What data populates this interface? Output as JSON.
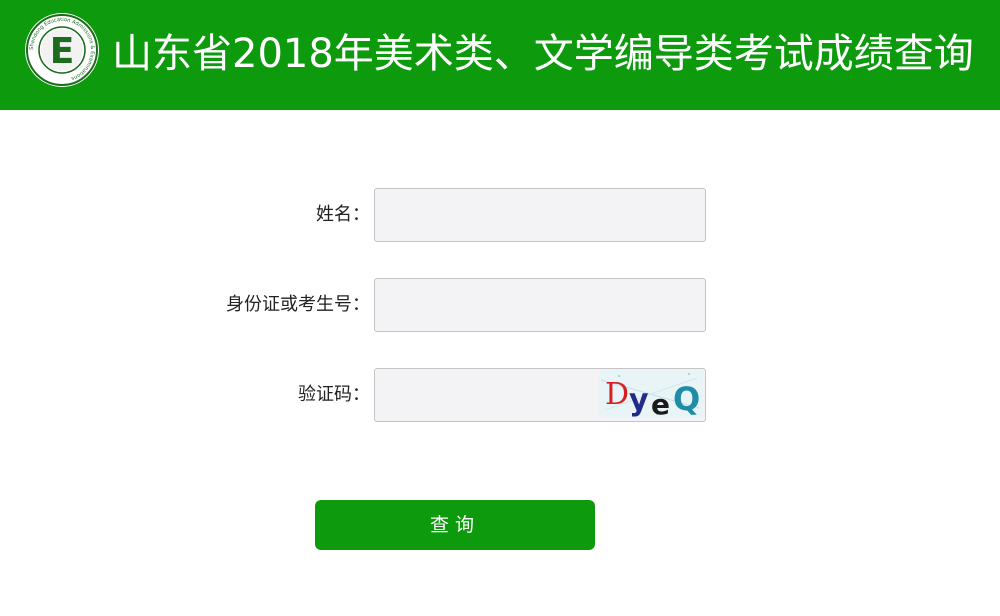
{
  "header": {
    "title": "山东省2018年美术类、文学编导类考试成绩查询",
    "background_color": "#0d9a0d",
    "logo": {
      "icon": "exam-institute-logo-icon",
      "letter": "E",
      "ring_text": "Shandong Education Admissions & Examinations"
    }
  },
  "form": {
    "name_label": "姓名：",
    "name_value": "",
    "id_label": "身份证或考生号：",
    "id_value": "",
    "captcha_label": "验证码：",
    "captcha_value": "",
    "captcha_image": {
      "characters": [
        "D",
        "y",
        "e",
        "Q"
      ],
      "colors": [
        "#d42020",
        "#222a8c",
        "#1a1a1a",
        "#1e8da8"
      ]
    }
  },
  "actions": {
    "query_label": "查询",
    "button_color": "#0d9a0d"
  }
}
